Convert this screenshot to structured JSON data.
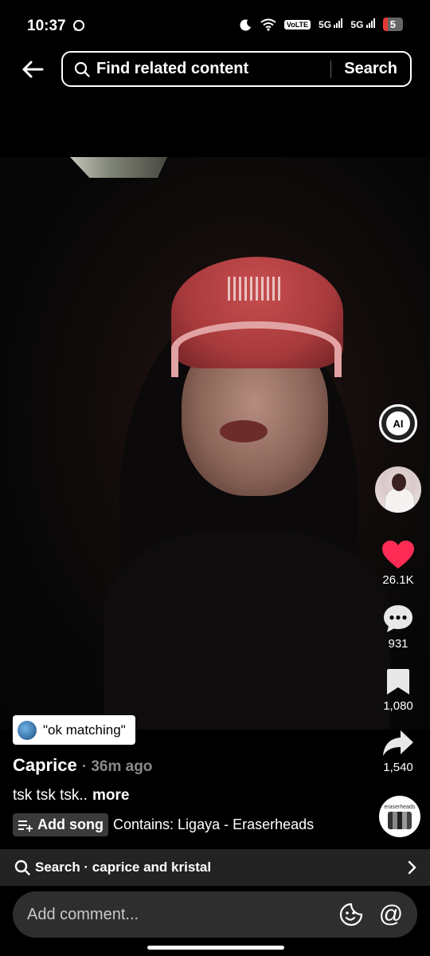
{
  "status_bar": {
    "time": "10:37",
    "volte": "VoLTE",
    "network_1": "5G",
    "network_2": "5G",
    "battery": "5"
  },
  "top_bar": {
    "search_placeholder": "Find related content",
    "search_button": "Search"
  },
  "video": {
    "sticker_text": "\"ok matching\""
  },
  "post": {
    "author": "Caprice",
    "time": "· 36m ago",
    "caption": "tsk tsk tsk..",
    "more_label": "more",
    "add_song_label": "Add song",
    "contains_text": "Contains: Ligaya - Eraserheads"
  },
  "actions": {
    "ai_label": "AI",
    "likes": "26.1K",
    "comments": "931",
    "saves": "1,080",
    "shares": "1,540",
    "music_disc_label": "eraserheads"
  },
  "related_search": {
    "label": "Search · caprice and kristal"
  },
  "comment_bar": {
    "placeholder": "Add comment...",
    "mention_symbol": "@"
  },
  "colors": {
    "like_red": "#fe2c55",
    "background": "#000000"
  }
}
